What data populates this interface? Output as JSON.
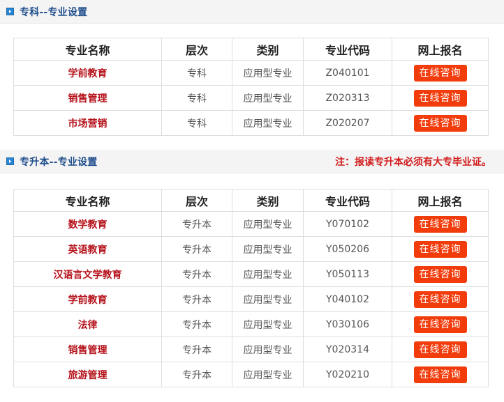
{
  "sections": [
    {
      "title": "专科--专业设置",
      "note": "",
      "headers": [
        "专业名称",
        "层次",
        "类别",
        "专业代码",
        "网上报名"
      ],
      "rows": [
        {
          "name": "学前教育",
          "level": "专科",
          "category": "应用型专业",
          "code": "Z040101",
          "action": "在线咨询"
        },
        {
          "name": "销售管理",
          "level": "专科",
          "category": "应用型专业",
          "code": "Z020313",
          "action": "在线咨询"
        },
        {
          "name": "市场营销",
          "level": "专科",
          "category": "应用型专业",
          "code": "Z020207",
          "action": "在线咨询"
        }
      ]
    },
    {
      "title": "专升本--专业设置",
      "note": "注：报读专升本必须有大专毕业证。",
      "headers": [
        "专业名称",
        "层次",
        "类别",
        "专业代码",
        "网上报名"
      ],
      "rows": [
        {
          "name": "数学教育",
          "level": "专升本",
          "category": "应用型专业",
          "code": "Y070102",
          "action": "在线咨询"
        },
        {
          "name": "英语教育",
          "level": "专升本",
          "category": "应用型专业",
          "code": "Y050206",
          "action": "在线咨询"
        },
        {
          "name": "汉语言文学教育",
          "level": "专升本",
          "category": "应用型专业",
          "code": "Y050113",
          "action": "在线咨询"
        },
        {
          "name": "学前教育",
          "level": "专升本",
          "category": "应用型专业",
          "code": "Y040102",
          "action": "在线咨询"
        },
        {
          "name": "法律",
          "level": "专升本",
          "category": "应用型专业",
          "code": "Y030106",
          "action": "在线咨询"
        },
        {
          "name": "销售管理",
          "level": "专升本",
          "category": "应用型专业",
          "code": "Y020314",
          "action": "在线咨询"
        },
        {
          "name": "旅游管理",
          "level": "专升本",
          "category": "应用型专业",
          "code": "Y020210",
          "action": "在线咨询"
        }
      ]
    }
  ],
  "colors": {
    "section_title": "#1f4e8c",
    "note": "#d11a1a",
    "major_name": "#b5121b",
    "button_bg": "#f23c0c",
    "icon_bg": "#2a86d3"
  },
  "icons": {
    "section": "arrow-right-icon"
  }
}
